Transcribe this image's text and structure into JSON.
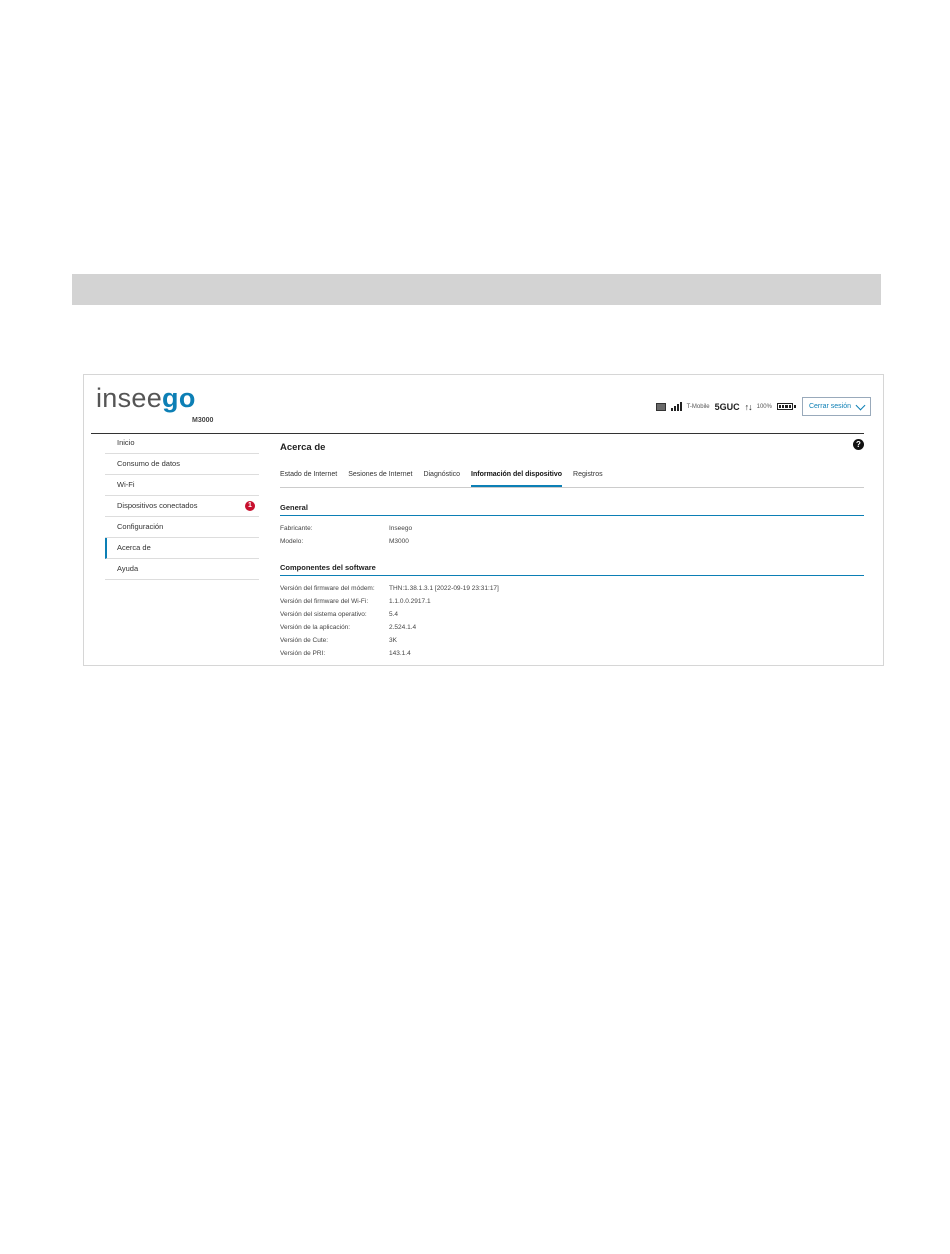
{
  "header": {
    "logo_text_a": "insee",
    "logo_text_b": "go",
    "model": "M3000",
    "carrier": "T-Mobile",
    "network": "5GUC",
    "arrows": "↑↓",
    "battery": "100%",
    "logout_label": "Cerrar sesión"
  },
  "sidebar": {
    "items": [
      {
        "label": "Inicio"
      },
      {
        "label": "Consumo de datos"
      },
      {
        "label": "Wi-Fi"
      },
      {
        "label": "Dispositivos conectados",
        "badge": "1"
      },
      {
        "label": "Configuración"
      },
      {
        "label": "Acerca de"
      },
      {
        "label": "Ayuda"
      }
    ]
  },
  "main": {
    "title": "Acerca de",
    "help": "?",
    "tabs": [
      {
        "label": "Estado de Internet"
      },
      {
        "label": "Sesiones de Internet"
      },
      {
        "label": "Diagnóstico"
      },
      {
        "label": "Información del dispositivo"
      },
      {
        "label": "Registros"
      }
    ],
    "general": {
      "heading": "General",
      "rows": [
        {
          "key": "Fabricante:",
          "value": "Inseego"
        },
        {
          "key": "Modelo:",
          "value": "M3000"
        }
      ]
    },
    "software": {
      "heading": "Componentes del software",
      "rows": [
        {
          "key": "Versión del firmware del módem:",
          "value": "THN:1.38.1.3.1 [2022-09-19 23:31:17]"
        },
        {
          "key": "Versión del firmware del Wi-Fi:",
          "value": "1.1.0.0.2917.1"
        },
        {
          "key": "Versión del sistema operativo:",
          "value": "5.4"
        },
        {
          "key": "Versión de la aplicación:",
          "value": "2.524.1.4"
        },
        {
          "key": "Versión de Cute:",
          "value": "3K"
        },
        {
          "key": "Versión de PRI:",
          "value": "143.1.4"
        }
      ]
    }
  }
}
